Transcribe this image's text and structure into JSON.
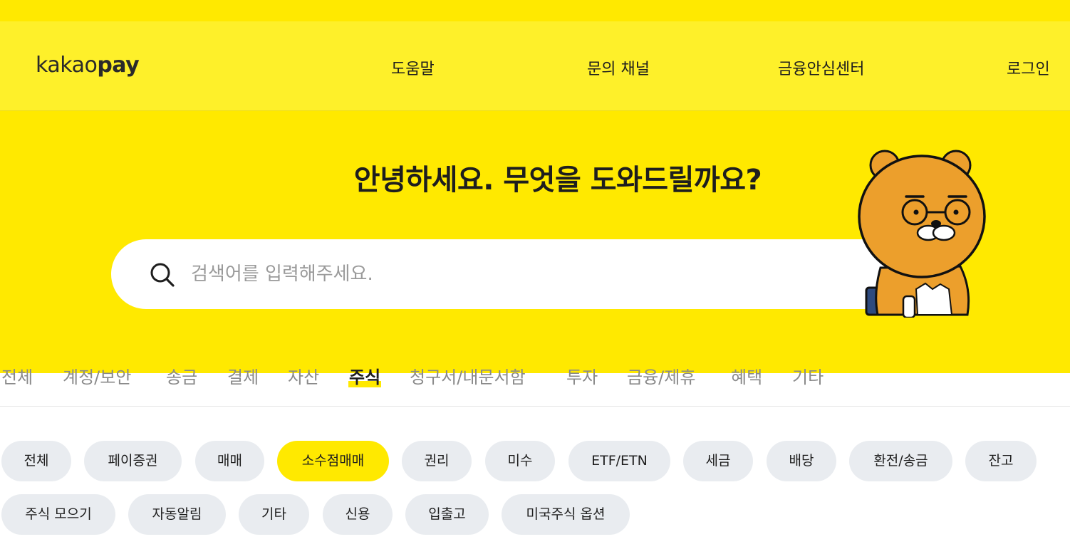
{
  "header": {
    "logo_thin": "kakao",
    "logo_bold": "pay",
    "nav": [
      "도움말",
      "문의 채널",
      "금융안심센터",
      "로그인"
    ]
  },
  "hero": {
    "title": "안녕하세요. 무엇을 도와드릴까요?",
    "search_placeholder": "검색어를 입력해주세요."
  },
  "category_tabs": [
    "전체",
    "계정/보안",
    "송금",
    "결제",
    "자산",
    "주식",
    "청구서/내문서함",
    "투자",
    "금융/제휴",
    "혜택",
    "기타"
  ],
  "active_category": "주식",
  "sub_chips_row1": [
    "전체",
    "페이증권",
    "매매",
    "소수점매매",
    "권리",
    "미수",
    "ETF/ETN",
    "세금",
    "배당",
    "환전/송금",
    "잔고"
  ],
  "sub_chips_row2": [
    "주식 모으기",
    "자동알림",
    "기타",
    "신용",
    "입출고",
    "미국주식 옵션"
  ],
  "active_sub_chip": "소수점매매",
  "colors": {
    "brand_yellow": "#ffe900",
    "header_yellow": "#fef02a",
    "chip_gray": "#e9ecf0",
    "mascot_orange": "#ec9f2c"
  }
}
